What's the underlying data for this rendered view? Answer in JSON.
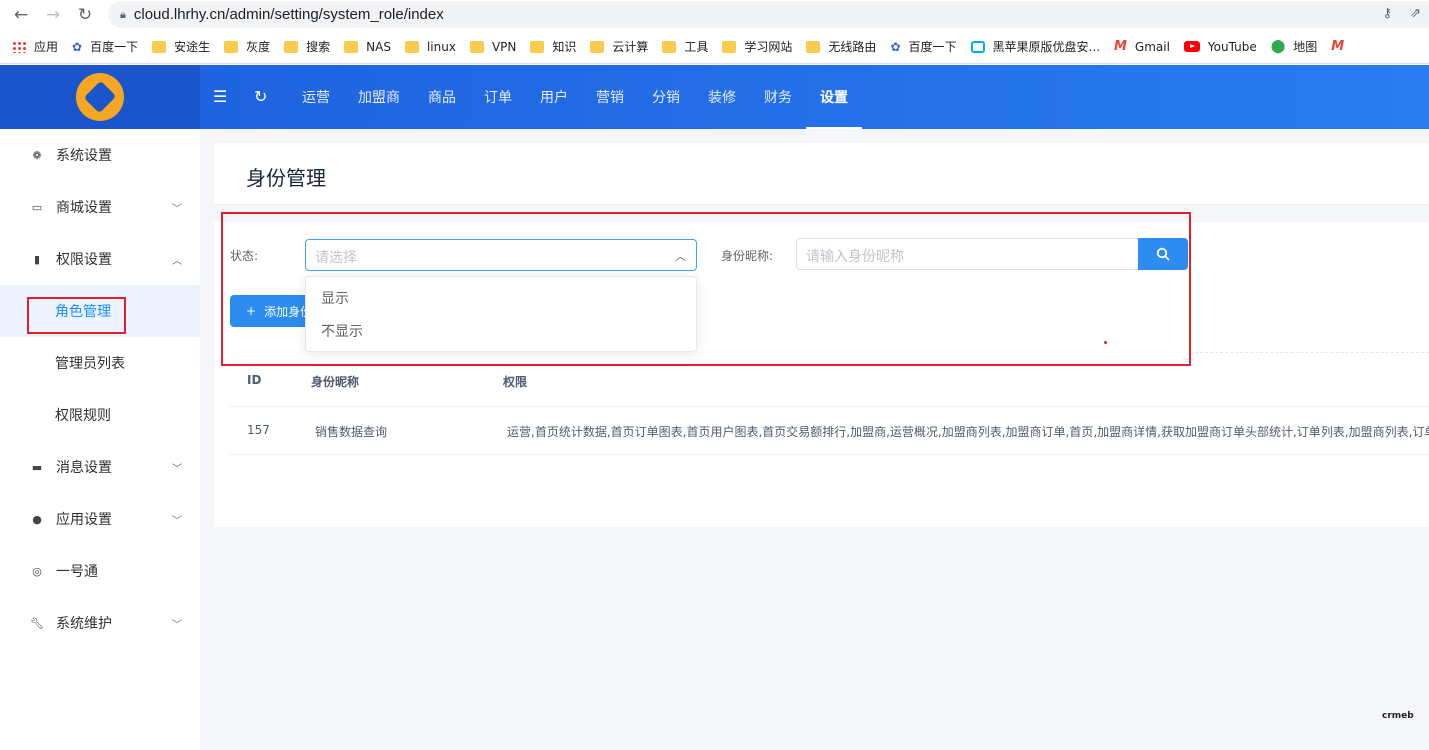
{
  "browser": {
    "url": "cloud.lhrhy.cn/admin/setting/system_role/index",
    "bookmarks": [
      "应用",
      "百度一下",
      "安途生",
      "灰度",
      "搜索",
      "NAS",
      "linux",
      "VPN",
      "知识",
      "云计算",
      "工具",
      "学习网站",
      "无线路由",
      "百度一下",
      "黑苹果原版优盘安...",
      "Gmail",
      "YouTube",
      "地图"
    ]
  },
  "header": {
    "nav": [
      "运营",
      "加盟商",
      "商品",
      "订单",
      "用户",
      "营销",
      "分销",
      "装修",
      "财务",
      "设置"
    ],
    "active": "设置"
  },
  "sidebar": {
    "items": [
      {
        "label": "系统设置",
        "icon": "gear-icon"
      },
      {
        "label": "商城设置",
        "icon": "shop-icon"
      },
      {
        "label": "权限设置",
        "icon": "bookmark-icon"
      },
      {
        "label": "角色管理"
      },
      {
        "label": "管理员列表"
      },
      {
        "label": "权限规则"
      },
      {
        "label": "消息设置",
        "icon": "message-icon"
      },
      {
        "label": "应用设置",
        "icon": "app-icon"
      },
      {
        "label": "一号通",
        "icon": "target-icon"
      },
      {
        "label": "系统维护",
        "icon": "wrench-icon"
      }
    ]
  },
  "page": {
    "title": "身份管理",
    "filter": {
      "status_label": "状态:",
      "status_placeholder": "请选择",
      "name_label": "身份昵称:",
      "name_placeholder": "请输入身份昵称"
    },
    "add_button": "添加身份",
    "dropdown_options": [
      "显示",
      "不显示"
    ],
    "table": {
      "headers": [
        "ID",
        "身份昵称",
        "权限"
      ],
      "rows": [
        {
          "id": "157",
          "name": "销售数据查询",
          "perms": "运营,首页统计数据,首页订单图表,首页用户图表,首页交易额排行,加盟商,运营概况,加盟商列表,加盟商订单,首页,加盟商详情,获取加盟商订单头部统计,订单列表,加盟商列表,订单"
        }
      ]
    }
  },
  "watermark": "crmeb"
}
